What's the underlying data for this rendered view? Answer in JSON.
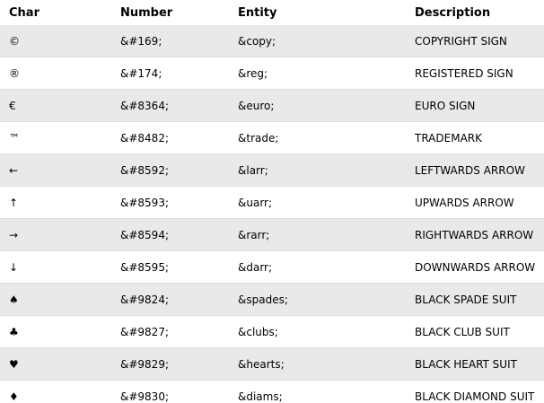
{
  "table": {
    "headers": {
      "char": "Char",
      "number": "Number",
      "entity": "Entity",
      "description": "Description"
    },
    "rows": [
      {
        "char": "©",
        "number": "&#169;",
        "entity": "&copy;",
        "description": "COPYRIGHT SIGN"
      },
      {
        "char": "®",
        "number": "&#174;",
        "entity": "&reg;",
        "description": "REGISTERED SIGN"
      },
      {
        "char": "€",
        "number": "&#8364;",
        "entity": "&euro;",
        "description": "EURO SIGN"
      },
      {
        "char": "™",
        "number": "&#8482;",
        "entity": "&trade;",
        "description": "TRADEMARK"
      },
      {
        "char": "←",
        "number": "&#8592;",
        "entity": "&larr;",
        "description": "LEFTWARDS ARROW"
      },
      {
        "char": "↑",
        "number": "&#8593;",
        "entity": "&uarr;",
        "description": "UPWARDS ARROW"
      },
      {
        "char": "→",
        "number": "&#8594;",
        "entity": "&rarr;",
        "description": "RIGHTWARDS ARROW"
      },
      {
        "char": "↓",
        "number": "&#8595;",
        "entity": "&darr;",
        "description": "DOWNWARDS ARROW"
      },
      {
        "char": "♠",
        "number": "&#9824;",
        "entity": "&spades;",
        "description": "BLACK SPADE SUIT"
      },
      {
        "char": "♣",
        "number": "&#9827;",
        "entity": "&clubs;",
        "description": "BLACK CLUB SUIT"
      },
      {
        "char": "♥",
        "number": "&#9829;",
        "entity": "&hearts;",
        "description": "BLACK HEART SUIT"
      },
      {
        "char": "♦",
        "number": "&#9830;",
        "entity": "&diams;",
        "description": "BLACK DIAMOND SUIT"
      }
    ]
  }
}
